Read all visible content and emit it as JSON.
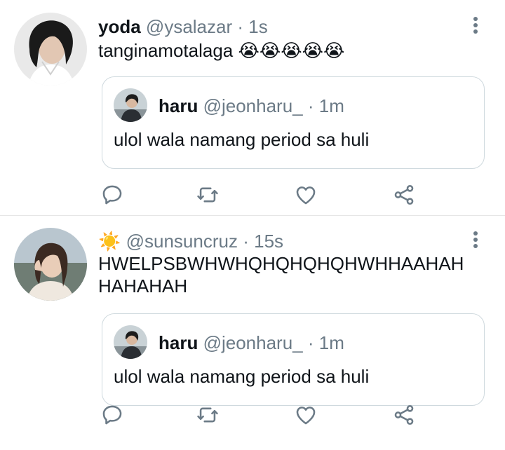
{
  "tweets": [
    {
      "display_name": "yoda",
      "handle": "@ysalazar",
      "separator": "·",
      "time": "1s",
      "text": "tanginamotalaga 😭😭😭😭😭",
      "quote": {
        "display_name": "haru",
        "handle": "@jeonharu_",
        "separator": "·",
        "time": "1m",
        "text": "ulol wala namang period sa huli"
      }
    },
    {
      "display_name": "☀️",
      "handle": "@sunsuncruz",
      "separator": "·",
      "time": "15s",
      "text": "HWELPSBWHWHQHQHQHQHWHHAAHAH HAHAHAH",
      "quote": {
        "display_name": "haru",
        "handle": "@jeonharu_",
        "separator": "·",
        "time": "1m",
        "text": "ulol wala namang period sa huli"
      }
    }
  ],
  "icons": [
    "reply-icon",
    "retweet-icon",
    "like-icon",
    "share-icon",
    "more-icon"
  ],
  "colors": {
    "secondary_text": "#6b7a86",
    "border": "#cfd9de",
    "divider": "#e6e6e6"
  }
}
